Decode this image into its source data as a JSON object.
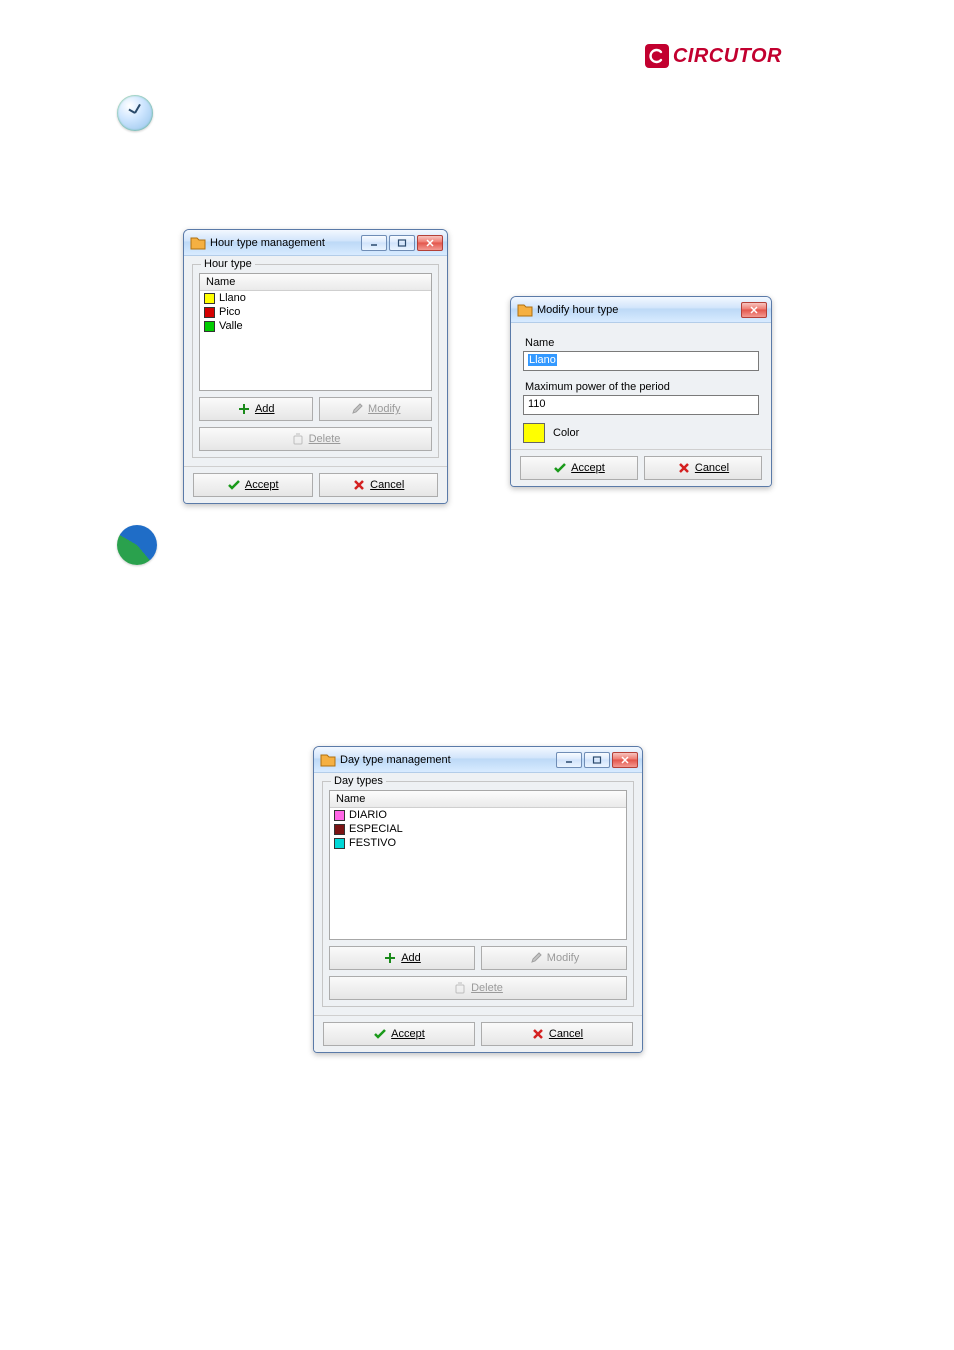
{
  "brand": {
    "name": "CIRCUTOR"
  },
  "dialog1": {
    "title": "Hour type management",
    "group_legend": "Hour type",
    "list_header": "Name",
    "items": [
      {
        "label": "Llano",
        "color": "#ffff00"
      },
      {
        "label": "Pico",
        "color": "#d40000"
      },
      {
        "label": "Valle",
        "color": "#00cc00"
      }
    ],
    "buttons": {
      "add": "Add",
      "modify": "Modify",
      "delete": "Delete",
      "accept": "Accept",
      "cancel": "Cancel"
    }
  },
  "dialog2": {
    "title": "Modify hour type",
    "name_label": "Name",
    "name_value": "Llano",
    "max_label": "Maximum power of the period",
    "max_value": "110",
    "color_label": "Color",
    "color_value": "#ffff00",
    "buttons": {
      "accept": "Accept",
      "cancel": "Cancel"
    }
  },
  "dialog3": {
    "title": "Day type management",
    "group_legend": "Day types",
    "list_header": "Name",
    "items": [
      {
        "label": "DIARIO",
        "color": "#ff66e6"
      },
      {
        "label": "ESPECIAL",
        "color": "#7a1313"
      },
      {
        "label": "FESTIVO",
        "color": "#00d7d7"
      }
    ],
    "buttons": {
      "add": "Add",
      "modify": "Modify",
      "delete": "Delete",
      "accept": "Accept",
      "cancel": "Cancel"
    }
  }
}
